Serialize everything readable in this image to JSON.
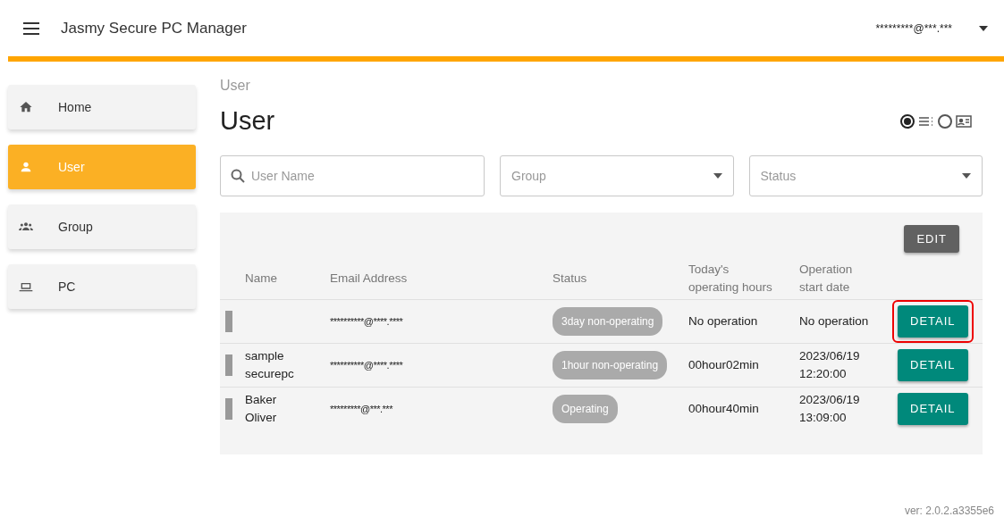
{
  "app_bar": {
    "title": "Jasmy Secure PC Manager",
    "account": "*********@***.***"
  },
  "sidebar": {
    "items": [
      {
        "label": "Home",
        "selected": false
      },
      {
        "label": "User",
        "selected": true
      },
      {
        "label": "Group",
        "selected": false
      },
      {
        "label": "PC",
        "selected": false
      }
    ]
  },
  "breadcrumb": "User",
  "page_title": "User",
  "view_options": [
    {
      "kind": "list",
      "selected": true
    },
    {
      "kind": "card",
      "selected": false
    }
  ],
  "filters": {
    "search": {
      "placeholder": "User Name"
    },
    "group": {
      "placeholder": "Group"
    },
    "status": {
      "placeholder": "Status"
    }
  },
  "table": {
    "edit_button": "EDIT",
    "columns": [
      "Name",
      "Email Address",
      "Status",
      "Today's\noperating hours",
      "Operation\nstart date"
    ],
    "rows": [
      {
        "name": "",
        "email": "**********@****.****",
        "status": "3day non-operating",
        "hours": "No operation",
        "start": "No operation",
        "button": "DETAIL",
        "highlighted": true
      },
      {
        "name": "sample\nsecurepc",
        "email": "**********@****.****",
        "status": "1hour non-operating",
        "hours": "00hour02min",
        "start": "2023/06/19\n12:20:00",
        "button": "DETAIL",
        "highlighted": false
      },
      {
        "name": "Baker\nOliver",
        "email": "*********@***.***",
        "status": "Operating",
        "hours": "00hour40min",
        "start": "2023/06/19\n13:09:00",
        "button": "DETAIL",
        "highlighted": false
      }
    ]
  },
  "version": "ver: 2.0.2.a3355e6"
}
